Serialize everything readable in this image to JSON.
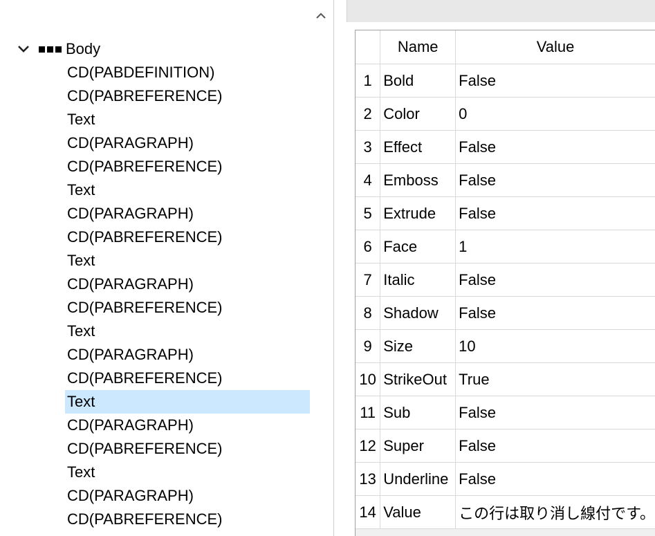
{
  "tree": {
    "root_label": "Body",
    "expander_icon": "chevron-down-icon",
    "items": [
      {
        "label": "CD(PABDEFINITION)",
        "selected": false
      },
      {
        "label": "CD(PABREFERENCE)",
        "selected": false
      },
      {
        "label": "Text",
        "selected": false
      },
      {
        "label": "CD(PARAGRAPH)",
        "selected": false
      },
      {
        "label": "CD(PABREFERENCE)",
        "selected": false
      },
      {
        "label": "Text",
        "selected": false
      },
      {
        "label": "CD(PARAGRAPH)",
        "selected": false
      },
      {
        "label": "CD(PABREFERENCE)",
        "selected": false
      },
      {
        "label": "Text",
        "selected": false
      },
      {
        "label": "CD(PARAGRAPH)",
        "selected": false
      },
      {
        "label": "CD(PABREFERENCE)",
        "selected": false
      },
      {
        "label": "Text",
        "selected": false
      },
      {
        "label": "CD(PARAGRAPH)",
        "selected": false
      },
      {
        "label": "CD(PABREFERENCE)",
        "selected": false
      },
      {
        "label": "Text",
        "selected": true
      },
      {
        "label": "CD(PARAGRAPH)",
        "selected": false
      },
      {
        "label": "CD(PABREFERENCE)",
        "selected": false
      },
      {
        "label": "Text",
        "selected": false
      },
      {
        "label": "CD(PARAGRAPH)",
        "selected": false
      },
      {
        "label": "CD(PABREFERENCE)",
        "selected": false
      }
    ],
    "selection_color": "#cce8ff"
  },
  "grid": {
    "columns": {
      "name": "Name",
      "value": "Value"
    },
    "rows": [
      {
        "num": "1",
        "name": "Bold",
        "value": "False"
      },
      {
        "num": "2",
        "name": "Color",
        "value": "0"
      },
      {
        "num": "3",
        "name": "Effect",
        "value": "False"
      },
      {
        "num": "4",
        "name": "Emboss",
        "value": "False"
      },
      {
        "num": "5",
        "name": "Extrude",
        "value": "False"
      },
      {
        "num": "6",
        "name": "Face",
        "value": "1"
      },
      {
        "num": "7",
        "name": "Italic",
        "value": "False"
      },
      {
        "num": "8",
        "name": "Shadow",
        "value": "False"
      },
      {
        "num": "9",
        "name": "Size",
        "value": "10"
      },
      {
        "num": "10",
        "name": "StrikeOut",
        "value": "True"
      },
      {
        "num": "11",
        "name": "Sub",
        "value": "False"
      },
      {
        "num": "12",
        "name": "Super",
        "value": "False"
      },
      {
        "num": "13",
        "name": "Underline",
        "value": "False"
      },
      {
        "num": "14",
        "name": "Value",
        "value": "この行は取り消し線付です。"
      }
    ]
  }
}
